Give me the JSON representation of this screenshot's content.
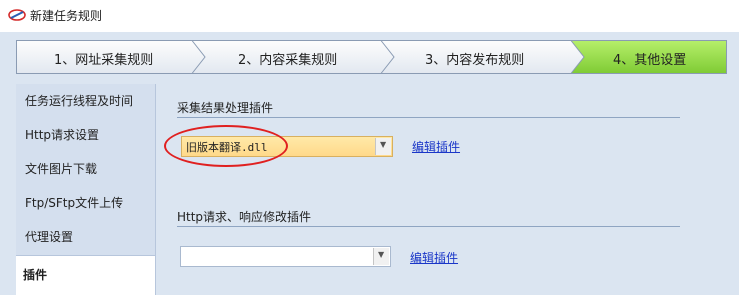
{
  "window": {
    "title": "新建任务规则"
  },
  "steps": [
    {
      "label": "1、网址采集规则",
      "state": "inactive"
    },
    {
      "label": "2、内容采集规则",
      "state": "inactive"
    },
    {
      "label": "3、内容发布规则",
      "state": "inactive"
    },
    {
      "label": "4、其他设置",
      "state": "active"
    }
  ],
  "sidebar": {
    "items": [
      {
        "label": "任务运行线程及时间"
      },
      {
        "label": "Http请求设置"
      },
      {
        "label": "文件图片下载"
      },
      {
        "label": "Ftp/SFtp文件上传"
      },
      {
        "label": "代理设置"
      },
      {
        "label": "插件",
        "selected": true
      }
    ]
  },
  "main": {
    "collect_plugin": {
      "section_title": "采集结果处理插件",
      "selected_value": "旧版本翻译.dll",
      "edit_link": "编辑插件"
    },
    "http_plugin": {
      "section_title": "Http请求、响应修改插件",
      "selected_value": "",
      "edit_link": "编辑插件"
    }
  },
  "colors": {
    "active_step": "#8fd642",
    "panel_bg": "#dbe5f1",
    "highlight": "#ffd98a",
    "annotation": "#e02020"
  }
}
